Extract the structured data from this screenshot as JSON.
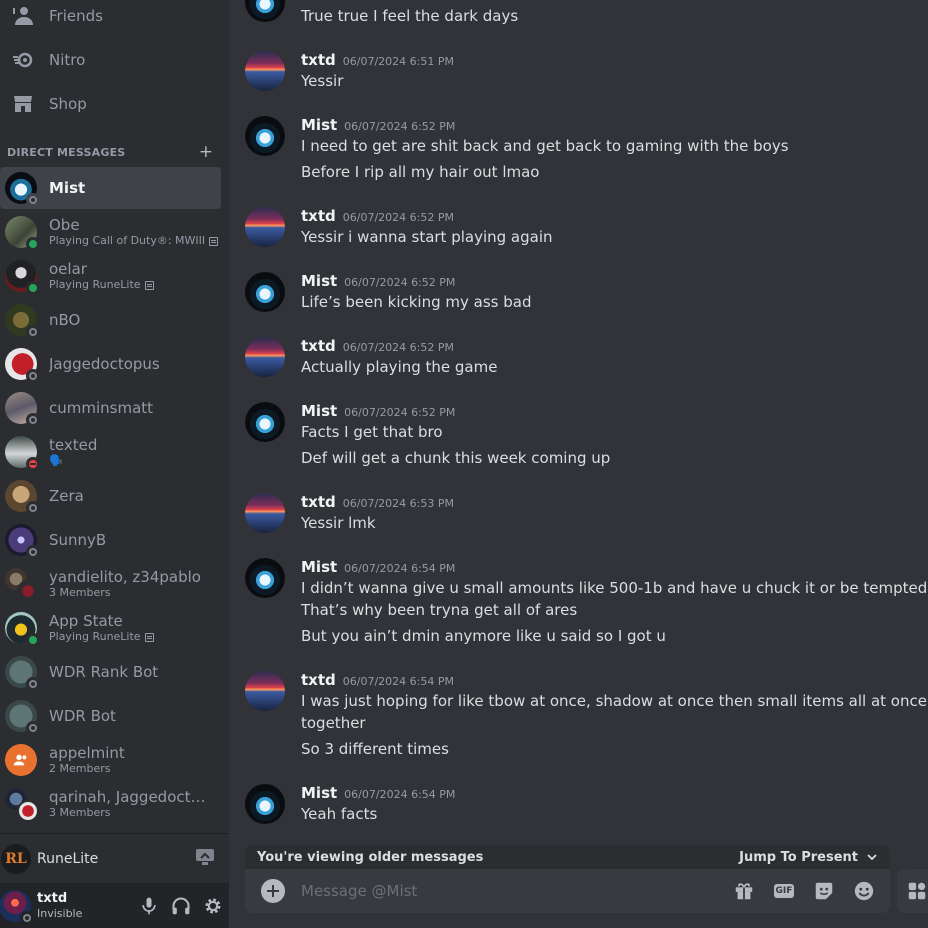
{
  "nav": {
    "friends": "Friends",
    "nitro": "Nitro",
    "shop": "Shop"
  },
  "dm_header": "DIRECT MESSAGES",
  "dms": [
    {
      "name": "Mist",
      "sub": "",
      "status": "offline",
      "active": true
    },
    {
      "name": "Obe",
      "sub": "Playing Call of Duty®: MWIII",
      "status": "online"
    },
    {
      "name": "oelar",
      "sub": "Playing RuneLite",
      "status": "online"
    },
    {
      "name": "nBO",
      "sub": "",
      "status": "offline"
    },
    {
      "name": "Jaggedoctopus",
      "sub": "",
      "status": "offline"
    },
    {
      "name": "cumminsmatt",
      "sub": "",
      "status": "offline"
    },
    {
      "name": "texted",
      "sub": "🗣️",
      "status": "dnd"
    },
    {
      "name": "Zera",
      "sub": "",
      "status": "offline"
    },
    {
      "name": "SunnyB",
      "sub": "",
      "status": "offline"
    },
    {
      "name": "yandielito, z34pablo",
      "sub": "3 Members",
      "status": ""
    },
    {
      "name": "App State",
      "sub": "Playing RuneLite",
      "status": "online"
    },
    {
      "name": "WDR Rank Bot",
      "sub": "",
      "status": "offline"
    },
    {
      "name": "WDR Bot",
      "sub": "",
      "status": "offline"
    },
    {
      "name": "appelmint",
      "sub": "2 Members",
      "status": ""
    },
    {
      "name": "qarinah, Jaggedoctop...",
      "sub": "3 Members",
      "status": ""
    }
  ],
  "activity": {
    "name": "RuneLite"
  },
  "user": {
    "name": "txtd",
    "status": "Invisible"
  },
  "messages": [
    {
      "author": "",
      "time": "",
      "lines": [
        "True true I feel the dark days"
      ]
    },
    {
      "author": "txtd",
      "time": "06/07/2024 6:51 PM",
      "lines": [
        "Yessir"
      ]
    },
    {
      "author": "Mist",
      "time": "06/07/2024 6:52 PM",
      "lines": [
        "I need to get are shit back and get back to gaming with the boys",
        "Before I rip all my hair out lmao"
      ]
    },
    {
      "author": "txtd",
      "time": "06/07/2024 6:52 PM",
      "lines": [
        "Yessir i wanna start playing again"
      ]
    },
    {
      "author": "Mist",
      "time": "06/07/2024 6:52 PM",
      "lines": [
        "Life’s been kicking my ass bad"
      ]
    },
    {
      "author": "txtd",
      "time": "06/07/2024 6:52 PM",
      "lines": [
        "Actually playing the game"
      ]
    },
    {
      "author": "Mist",
      "time": "06/07/2024 6:52 PM",
      "lines": [
        "Facts I get that bro",
        "Def will get a chunk this week coming up"
      ]
    },
    {
      "author": "txtd",
      "time": "06/07/2024 6:53 PM",
      "lines": [
        "Yessir lmk"
      ]
    },
    {
      "author": "Mist",
      "time": "06/07/2024 6:54 PM",
      "lines": [
        "I didn’t wanna give u small amounts like 500-1b and have u chuck it or be tempted",
        "That’s why been tryna get all of ares",
        "But you ain’t dmin anymore like u said so I got u"
      ]
    },
    {
      "author": "txtd",
      "time": "06/07/2024 6:54 PM",
      "lines": [
        "I was just hoping for like tbow at once, shadow at once then small items all at once",
        "together",
        "So 3 different times"
      ]
    },
    {
      "author": "Mist",
      "time": "06/07/2024 6:54 PM",
      "lines": [
        "Yeah facts"
      ]
    }
  ],
  "banner": {
    "text": "You're viewing older messages",
    "jump": "Jump To Present"
  },
  "composer": {
    "placeholder": "Message @Mist"
  },
  "colors": {
    "sidebar": "#2b2d31",
    "chat": "#313338",
    "online": "#23a55a",
    "dnd": "#f23f43",
    "offline": "#80848e"
  }
}
